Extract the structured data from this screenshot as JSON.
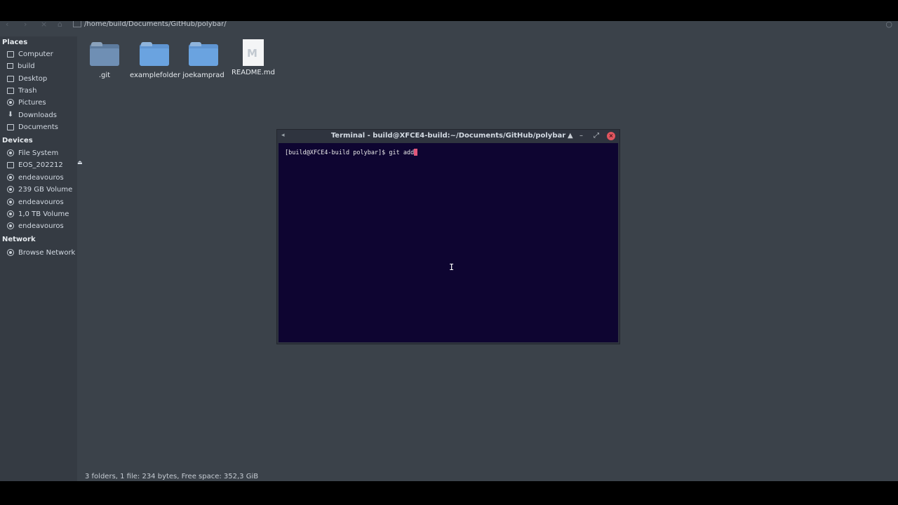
{
  "location": {
    "path": "/home/build/Documents/GitHub/polybar/"
  },
  "sidebar": {
    "places_header": "Places",
    "places": [
      {
        "label": "Computer",
        "icon": "computer-icon"
      },
      {
        "label": "build",
        "icon": "home-icon"
      },
      {
        "label": "Desktop",
        "icon": "desktop-icon"
      },
      {
        "label": "Trash",
        "icon": "trash-icon"
      },
      {
        "label": "Pictures",
        "icon": "camera-icon"
      },
      {
        "label": "Downloads",
        "icon": "download-icon"
      },
      {
        "label": "Documents",
        "icon": "documents-icon"
      }
    ],
    "devices_header": "Devices",
    "devices": [
      {
        "label": "File System",
        "icon": "drive-icon"
      },
      {
        "label": "EOS_202212",
        "icon": "usb-drive-icon",
        "eject": "eject-icon"
      },
      {
        "label": "endeavouros",
        "icon": "drive-icon"
      },
      {
        "label": "239 GB Volume",
        "icon": "drive-icon"
      },
      {
        "label": "endeavouros",
        "icon": "drive-icon"
      },
      {
        "label": "1,0 TB Volume",
        "icon": "drive-icon"
      },
      {
        "label": "endeavouros",
        "icon": "drive-icon"
      }
    ],
    "network_header": "Network",
    "network": [
      {
        "label": "Browse Network",
        "icon": "network-icon"
      }
    ]
  },
  "files": [
    {
      "name": ".git",
      "type": "folder-hidden"
    },
    {
      "name": "examplefolder",
      "type": "folder"
    },
    {
      "name": "joekamprad",
      "type": "folder"
    },
    {
      "name": "README.md",
      "type": "markdown-file"
    }
  ],
  "statusbar": {
    "text": "3 folders, 1 file: 234 bytes, Free space: 352,3 GiB"
  },
  "terminal": {
    "title": "Terminal - build@XFCE4-build:~/Documents/GitHub/polybar",
    "prompt": "[build@XFCE4-build polybar]$ git add",
    "controls": [
      "maximize-up-icon",
      "minimize-icon",
      "restore-icon",
      "close-icon"
    ]
  },
  "colors": {
    "terminal_bg": "#0e0531",
    "cursor": "#e0577a",
    "close_button": "#e0555f",
    "folder_blue": "#6aa3e0"
  }
}
